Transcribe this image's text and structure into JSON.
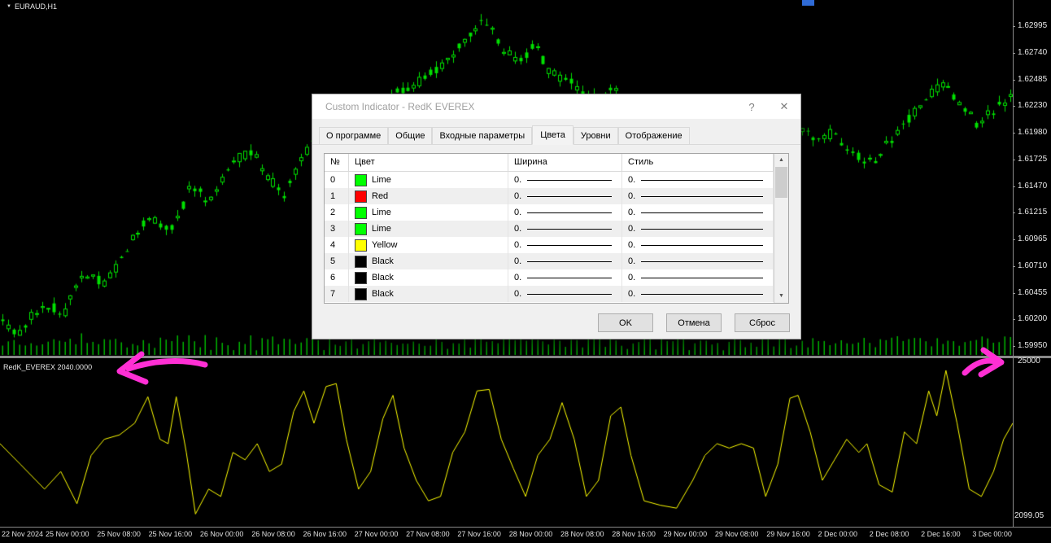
{
  "chart": {
    "symbol_label": "EURAUD,H1",
    "symbol_marker_icon": "▼",
    "indicator_label": "RedK_EVEREX 2040.0000",
    "indicator_scale_top": "25000",
    "indicator_scale_bottom": "2099.05",
    "price_axis_labels": [
      "1.62995",
      "1.62740",
      "1.62485",
      "1.62230",
      "1.61980",
      "1.61725",
      "1.61470",
      "1.61215",
      "1.60965",
      "1.60710",
      "1.60455",
      "1.60200",
      "1.59950"
    ],
    "time_axis_labels": [
      "22 Nov 2024",
      "25 Nov 00:00",
      "25 Nov 08:00",
      "25 Nov 16:00",
      "26 Nov 00:00",
      "26 Nov 08:00",
      "26 Nov 16:00",
      "27 Nov 00:00",
      "27 Nov 08:00",
      "27 Nov 16:00",
      "28 Nov 00:00",
      "28 Nov 08:00",
      "28 Nov 16:00",
      "29 Nov 00:00",
      "29 Nov 08:00",
      "29 Nov 16:00",
      "2 Dec 00:00",
      "2 Dec 08:00",
      "2 Dec 16:00",
      "3 Dec 00:00"
    ]
  },
  "dialog": {
    "title": "Custom Indicator - RedK EVEREX",
    "help_icon": "?",
    "close_icon": "✕",
    "tabs": [
      {
        "id": "tab-about",
        "label": "О программе",
        "active": false
      },
      {
        "id": "tab-common",
        "label": "Общие",
        "active": false
      },
      {
        "id": "tab-inputs",
        "label": "Входные параметры",
        "active": false
      },
      {
        "id": "tab-colors",
        "label": "Цвета",
        "active": true
      },
      {
        "id": "tab-levels",
        "label": "Уровни",
        "active": false
      },
      {
        "id": "tab-display",
        "label": "Отображение",
        "active": false
      }
    ],
    "table": {
      "headers": [
        "№",
        "Цвет",
        "Ширина",
        "Стиль"
      ],
      "rows": [
        {
          "index": "0",
          "color_name": "Lime",
          "color_hex": "#00FF00",
          "width_label": "0.",
          "style_label": "0."
        },
        {
          "index": "1",
          "color_name": "Red",
          "color_hex": "#FF0000",
          "width_label": "0.",
          "style_label": "0."
        },
        {
          "index": "2",
          "color_name": "Lime",
          "color_hex": "#00FF00",
          "width_label": "0.",
          "style_label": "0."
        },
        {
          "index": "3",
          "color_name": "Lime",
          "color_hex": "#00FF00",
          "width_label": "0.",
          "style_label": "0."
        },
        {
          "index": "4",
          "color_name": "Yellow",
          "color_hex": "#FFFF00",
          "width_label": "0.",
          "style_label": "0."
        },
        {
          "index": "5",
          "color_name": "Black",
          "color_hex": "#000000",
          "width_label": "0.",
          "style_label": "0."
        },
        {
          "index": "6",
          "color_name": "Black",
          "color_hex": "#000000",
          "width_label": "0.",
          "style_label": "0."
        },
        {
          "index": "7",
          "color_name": "Black",
          "color_hex": "#000000",
          "width_label": "0.",
          "style_label": "0."
        }
      ]
    },
    "scrollbar": {
      "up_icon": "▲",
      "down_icon": "▼"
    },
    "buttons": {
      "ok": "OK",
      "cancel": "Отмена",
      "reset": "Сброс"
    }
  },
  "chart_data": {
    "type": "candlestick",
    "symbol": "EURAUD",
    "timeframe": "H1",
    "price_range_top": 1.63243,
    "price_range_bottom": 1.59857,
    "candle_count": 180,
    "price_path": [
      [
        0.0,
        1.6022
      ],
      [
        0.016,
        1.6006
      ],
      [
        0.04,
        1.6035
      ],
      [
        0.064,
        1.6028
      ],
      [
        0.08,
        1.6062
      ],
      [
        0.104,
        1.6055
      ],
      [
        0.128,
        1.6092
      ],
      [
        0.148,
        1.6119
      ],
      [
        0.168,
        1.6103
      ],
      [
        0.188,
        1.6146
      ],
      [
        0.208,
        1.6134
      ],
      [
        0.228,
        1.6169
      ],
      [
        0.248,
        1.6181
      ],
      [
        0.264,
        1.6158
      ],
      [
        0.28,
        1.6134
      ],
      [
        0.296,
        1.6169
      ],
      [
        0.316,
        1.62
      ],
      [
        0.336,
        1.6208
      ],
      [
        0.352,
        1.6219
      ],
      [
        0.38,
        1.623
      ],
      [
        0.416,
        1.6247
      ],
      [
        0.444,
        1.627
      ],
      [
        0.464,
        1.629
      ],
      [
        0.48,
        1.6305
      ],
      [
        0.496,
        1.6278
      ],
      [
        0.512,
        1.6266
      ],
      [
        0.528,
        1.6282
      ],
      [
        0.544,
        1.6255
      ],
      [
        0.564,
        1.6247
      ],
      [
        0.58,
        1.6227
      ],
      [
        0.608,
        1.6239
      ],
      [
        0.632,
        1.6223
      ],
      [
        0.66,
        1.621
      ],
      [
        0.7,
        1.6195
      ],
      [
        0.74,
        1.6185
      ],
      [
        0.76,
        1.6178
      ],
      [
        0.792,
        1.62
      ],
      [
        0.808,
        1.6188
      ],
      [
        0.824,
        1.62
      ],
      [
        0.84,
        1.6177
      ],
      [
        0.86,
        1.6169
      ],
      [
        0.88,
        1.6192
      ],
      [
        0.9,
        1.6215
      ],
      [
        0.92,
        1.6235
      ],
      [
        0.933,
        1.6247
      ],
      [
        0.948,
        1.6223
      ],
      [
        0.964,
        1.6207
      ],
      [
        0.98,
        1.6219
      ],
      [
        1.0,
        1.6231
      ]
    ],
    "indicator_path": [
      [
        0.0,
        0.5
      ],
      [
        0.02,
        0.64
      ],
      [
        0.044,
        0.81
      ],
      [
        0.06,
        0.69
      ],
      [
        0.076,
        0.91
      ],
      [
        0.09,
        0.58
      ],
      [
        0.103,
        0.47
      ],
      [
        0.118,
        0.44
      ],
      [
        0.133,
        0.36
      ],
      [
        0.146,
        0.18
      ],
      [
        0.158,
        0.47
      ],
      [
        0.166,
        0.5
      ],
      [
        0.174,
        0.18
      ],
      [
        0.184,
        0.56
      ],
      [
        0.193,
        0.98
      ],
      [
        0.206,
        0.81
      ],
      [
        0.218,
        0.86
      ],
      [
        0.23,
        0.56
      ],
      [
        0.242,
        0.61
      ],
      [
        0.254,
        0.5
      ],
      [
        0.266,
        0.69
      ],
      [
        0.278,
        0.64
      ],
      [
        0.29,
        0.28
      ],
      [
        0.3,
        0.14
      ],
      [
        0.31,
        0.36
      ],
      [
        0.322,
        0.11
      ],
      [
        0.332,
        0.09
      ],
      [
        0.342,
        0.47
      ],
      [
        0.354,
        0.81
      ],
      [
        0.366,
        0.69
      ],
      [
        0.378,
        0.33
      ],
      [
        0.388,
        0.17
      ],
      [
        0.399,
        0.53
      ],
      [
        0.411,
        0.75
      ],
      [
        0.423,
        0.89
      ],
      [
        0.435,
        0.86
      ],
      [
        0.447,
        0.56
      ],
      [
        0.459,
        0.42
      ],
      [
        0.471,
        0.14
      ],
      [
        0.483,
        0.13
      ],
      [
        0.495,
        0.47
      ],
      [
        0.507,
        0.67
      ],
      [
        0.519,
        0.86
      ],
      [
        0.531,
        0.58
      ],
      [
        0.543,
        0.47
      ],
      [
        0.555,
        0.22
      ],
      [
        0.567,
        0.47
      ],
      [
        0.579,
        0.86
      ],
      [
        0.591,
        0.75
      ],
      [
        0.603,
        0.31
      ],
      [
        0.613,
        0.25
      ],
      [
        0.623,
        0.58
      ],
      [
        0.636,
        0.89
      ],
      [
        0.652,
        0.92
      ],
      [
        0.668,
        0.94
      ],
      [
        0.684,
        0.75
      ],
      [
        0.696,
        0.58
      ],
      [
        0.708,
        0.5
      ],
      [
        0.72,
        0.53
      ],
      [
        0.732,
        0.5
      ],
      [
        0.744,
        0.53
      ],
      [
        0.756,
        0.86
      ],
      [
        0.768,
        0.64
      ],
      [
        0.78,
        0.19
      ],
      [
        0.788,
        0.17
      ],
      [
        0.8,
        0.42
      ],
      [
        0.812,
        0.75
      ],
      [
        0.824,
        0.61
      ],
      [
        0.836,
        0.47
      ],
      [
        0.848,
        0.56
      ],
      [
        0.856,
        0.5
      ],
      [
        0.868,
        0.78
      ],
      [
        0.881,
        0.83
      ],
      [
        0.893,
        0.42
      ],
      [
        0.905,
        0.5
      ],
      [
        0.917,
        0.14
      ],
      [
        0.925,
        0.31
      ],
      [
        0.934,
        0.0
      ],
      [
        0.945,
        0.36
      ],
      [
        0.957,
        0.81
      ],
      [
        0.969,
        0.86
      ],
      [
        0.981,
        0.69
      ],
      [
        0.991,
        0.47
      ],
      [
        1.0,
        0.36
      ]
    ],
    "colors": {
      "candle": "#00E000",
      "volume": "#00B400",
      "indicator_line": "#FFFF00",
      "annotation": "#FF2FD4",
      "background": "#000000"
    }
  }
}
